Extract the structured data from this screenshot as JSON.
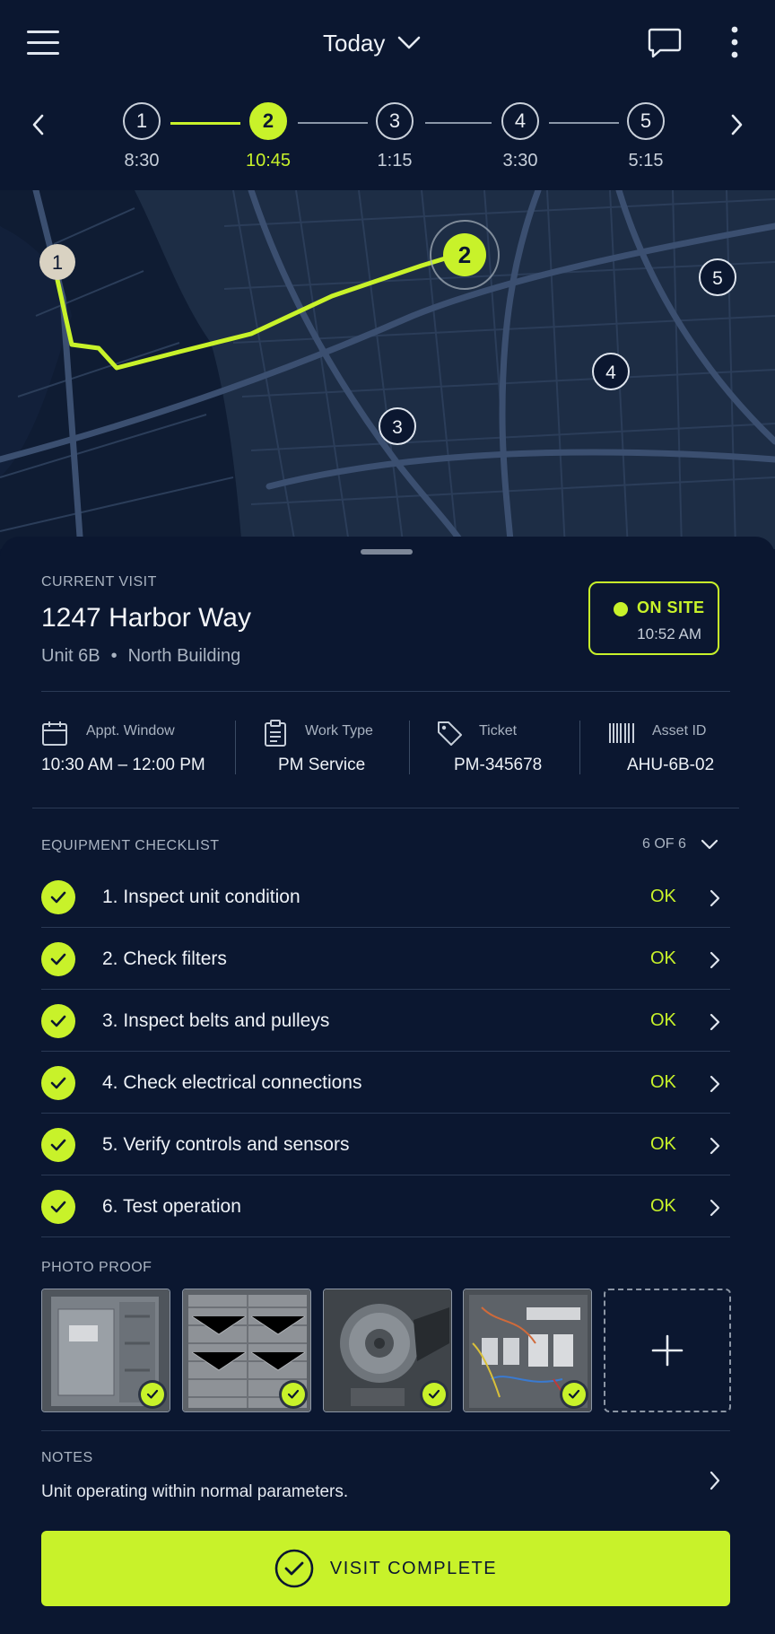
{
  "header": {
    "date_label": "Today",
    "menu_icon": "hamburger-menu-icon",
    "chat_icon": "chat-bubble-icon",
    "more_icon": "more-vertical-icon"
  },
  "timeline": {
    "stops": [
      {
        "number": "1",
        "time": "8:30",
        "state": "done"
      },
      {
        "number": "2",
        "time": "10:45",
        "state": "active"
      },
      {
        "number": "3",
        "time": "1:15",
        "state": "upcoming"
      },
      {
        "number": "4",
        "time": "3:30",
        "state": "upcoming"
      },
      {
        "number": "5",
        "time": "5:15",
        "state": "upcoming"
      }
    ]
  },
  "map": {
    "markers": [
      "1",
      "2",
      "3",
      "4",
      "5"
    ],
    "route_color": "#c8f22a"
  },
  "visit": {
    "label": "CURRENT VISIT",
    "address": "1247 Harbor Way",
    "unit": "Unit 6B",
    "separator": "•",
    "building": "North Building",
    "status": "ON SITE",
    "status_time": "10:52 AM"
  },
  "details": {
    "appt_label": "Appt. Window",
    "appt_value": "10:30 AM – 12:00 PM",
    "work_label": "Work Type",
    "work_value": "PM Service",
    "ticket_label": "Ticket",
    "ticket_value": "PM-345678",
    "asset_label": "Asset ID",
    "asset_value": "AHU-6B-02"
  },
  "checklist": {
    "title": "EQUIPMENT CHECKLIST",
    "count": "6 OF 6",
    "items": [
      {
        "text": "1. Inspect unit condition",
        "status": "OK"
      },
      {
        "text": "2. Check filters",
        "status": "OK"
      },
      {
        "text": "3. Inspect belts and pulleys",
        "status": "OK"
      },
      {
        "text": "4. Check electrical connections",
        "status": "OK"
      },
      {
        "text": "5. Verify controls and sensors",
        "status": "OK"
      },
      {
        "text": "6. Test operation",
        "status": "OK"
      }
    ]
  },
  "photos": {
    "title": "PHOTO PROOF",
    "items": [
      "unit-panel-photo",
      "filter-photo",
      "belt-pulley-photo",
      "electrical-panel-photo"
    ]
  },
  "notes": {
    "title": "NOTES",
    "text": "Unit operating within normal parameters."
  },
  "actions": {
    "complete_label": "VISIT COMPLETE"
  },
  "colors": {
    "accent": "#c8f22a",
    "background": "#0b1730"
  }
}
